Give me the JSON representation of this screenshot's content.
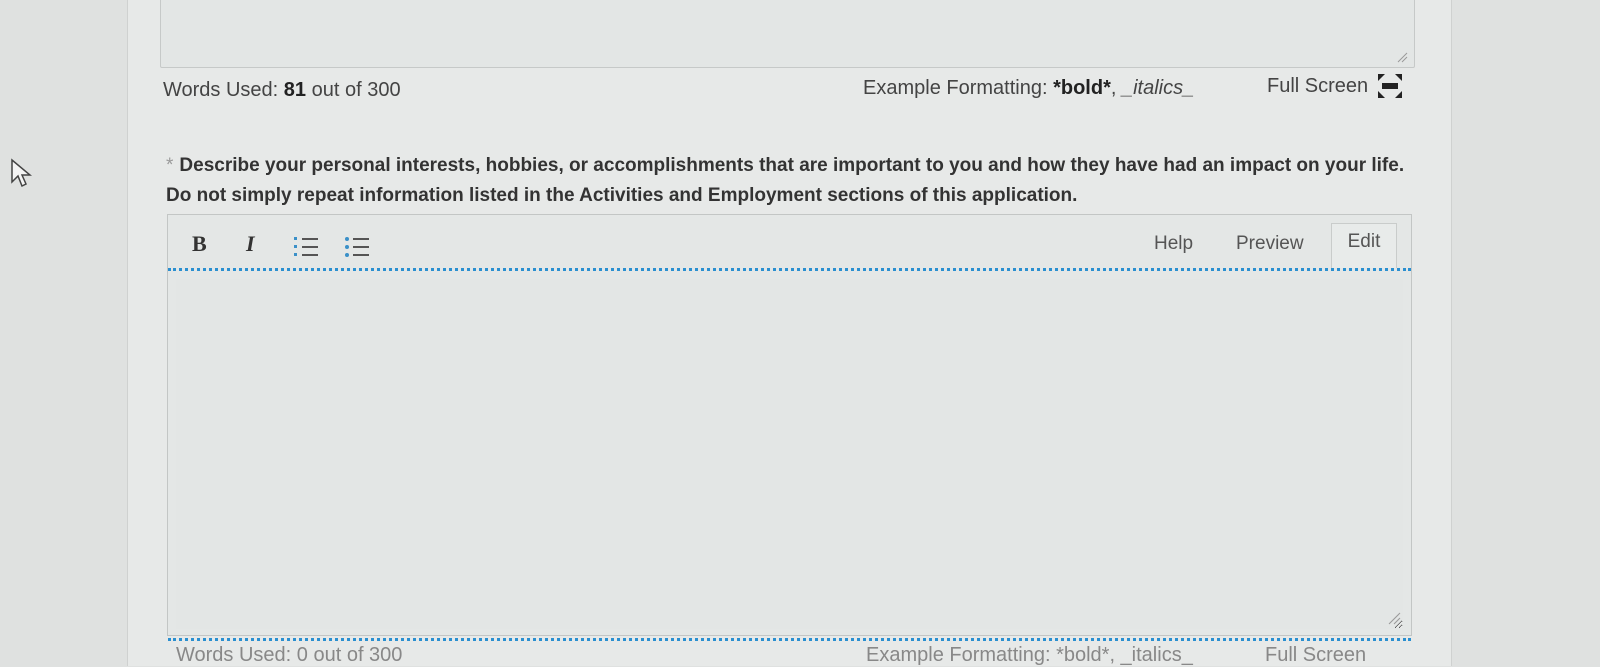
{
  "previous_field": {
    "word_count": {
      "prefix": "Words Used:",
      "used": "81",
      "suffix": "out of 300"
    },
    "example_formatting": {
      "label": "Example Formatting:",
      "bold_example": "*bold*",
      "separator": ", ",
      "italic_example": "_italics_"
    },
    "fullscreen": {
      "label": "Full Screen",
      "icon": "fullscreen-icon"
    }
  },
  "question": {
    "required_marker": "*",
    "text": "Describe your personal interests, hobbies, or accomplishments that are important to you and how they have had an impact on your life. Do not simply repeat information listed in the Activities and Employment sections of this application."
  },
  "editor": {
    "toolbar": {
      "bold_label": "B",
      "italic_label": "I",
      "ordered_list_icon": "ordered-list-icon",
      "unordered_list_icon": "unordered-list-icon",
      "help_label": "Help",
      "preview_label": "Preview",
      "edit_label": "Edit"
    },
    "value": "",
    "accent_color": "#2a8fd0"
  },
  "next_field": {
    "word_count": "Words Used: 0 out of 300",
    "example_formatting": "Example Formatting: *bold*, _italics_",
    "fullscreen": "Full Screen"
  }
}
